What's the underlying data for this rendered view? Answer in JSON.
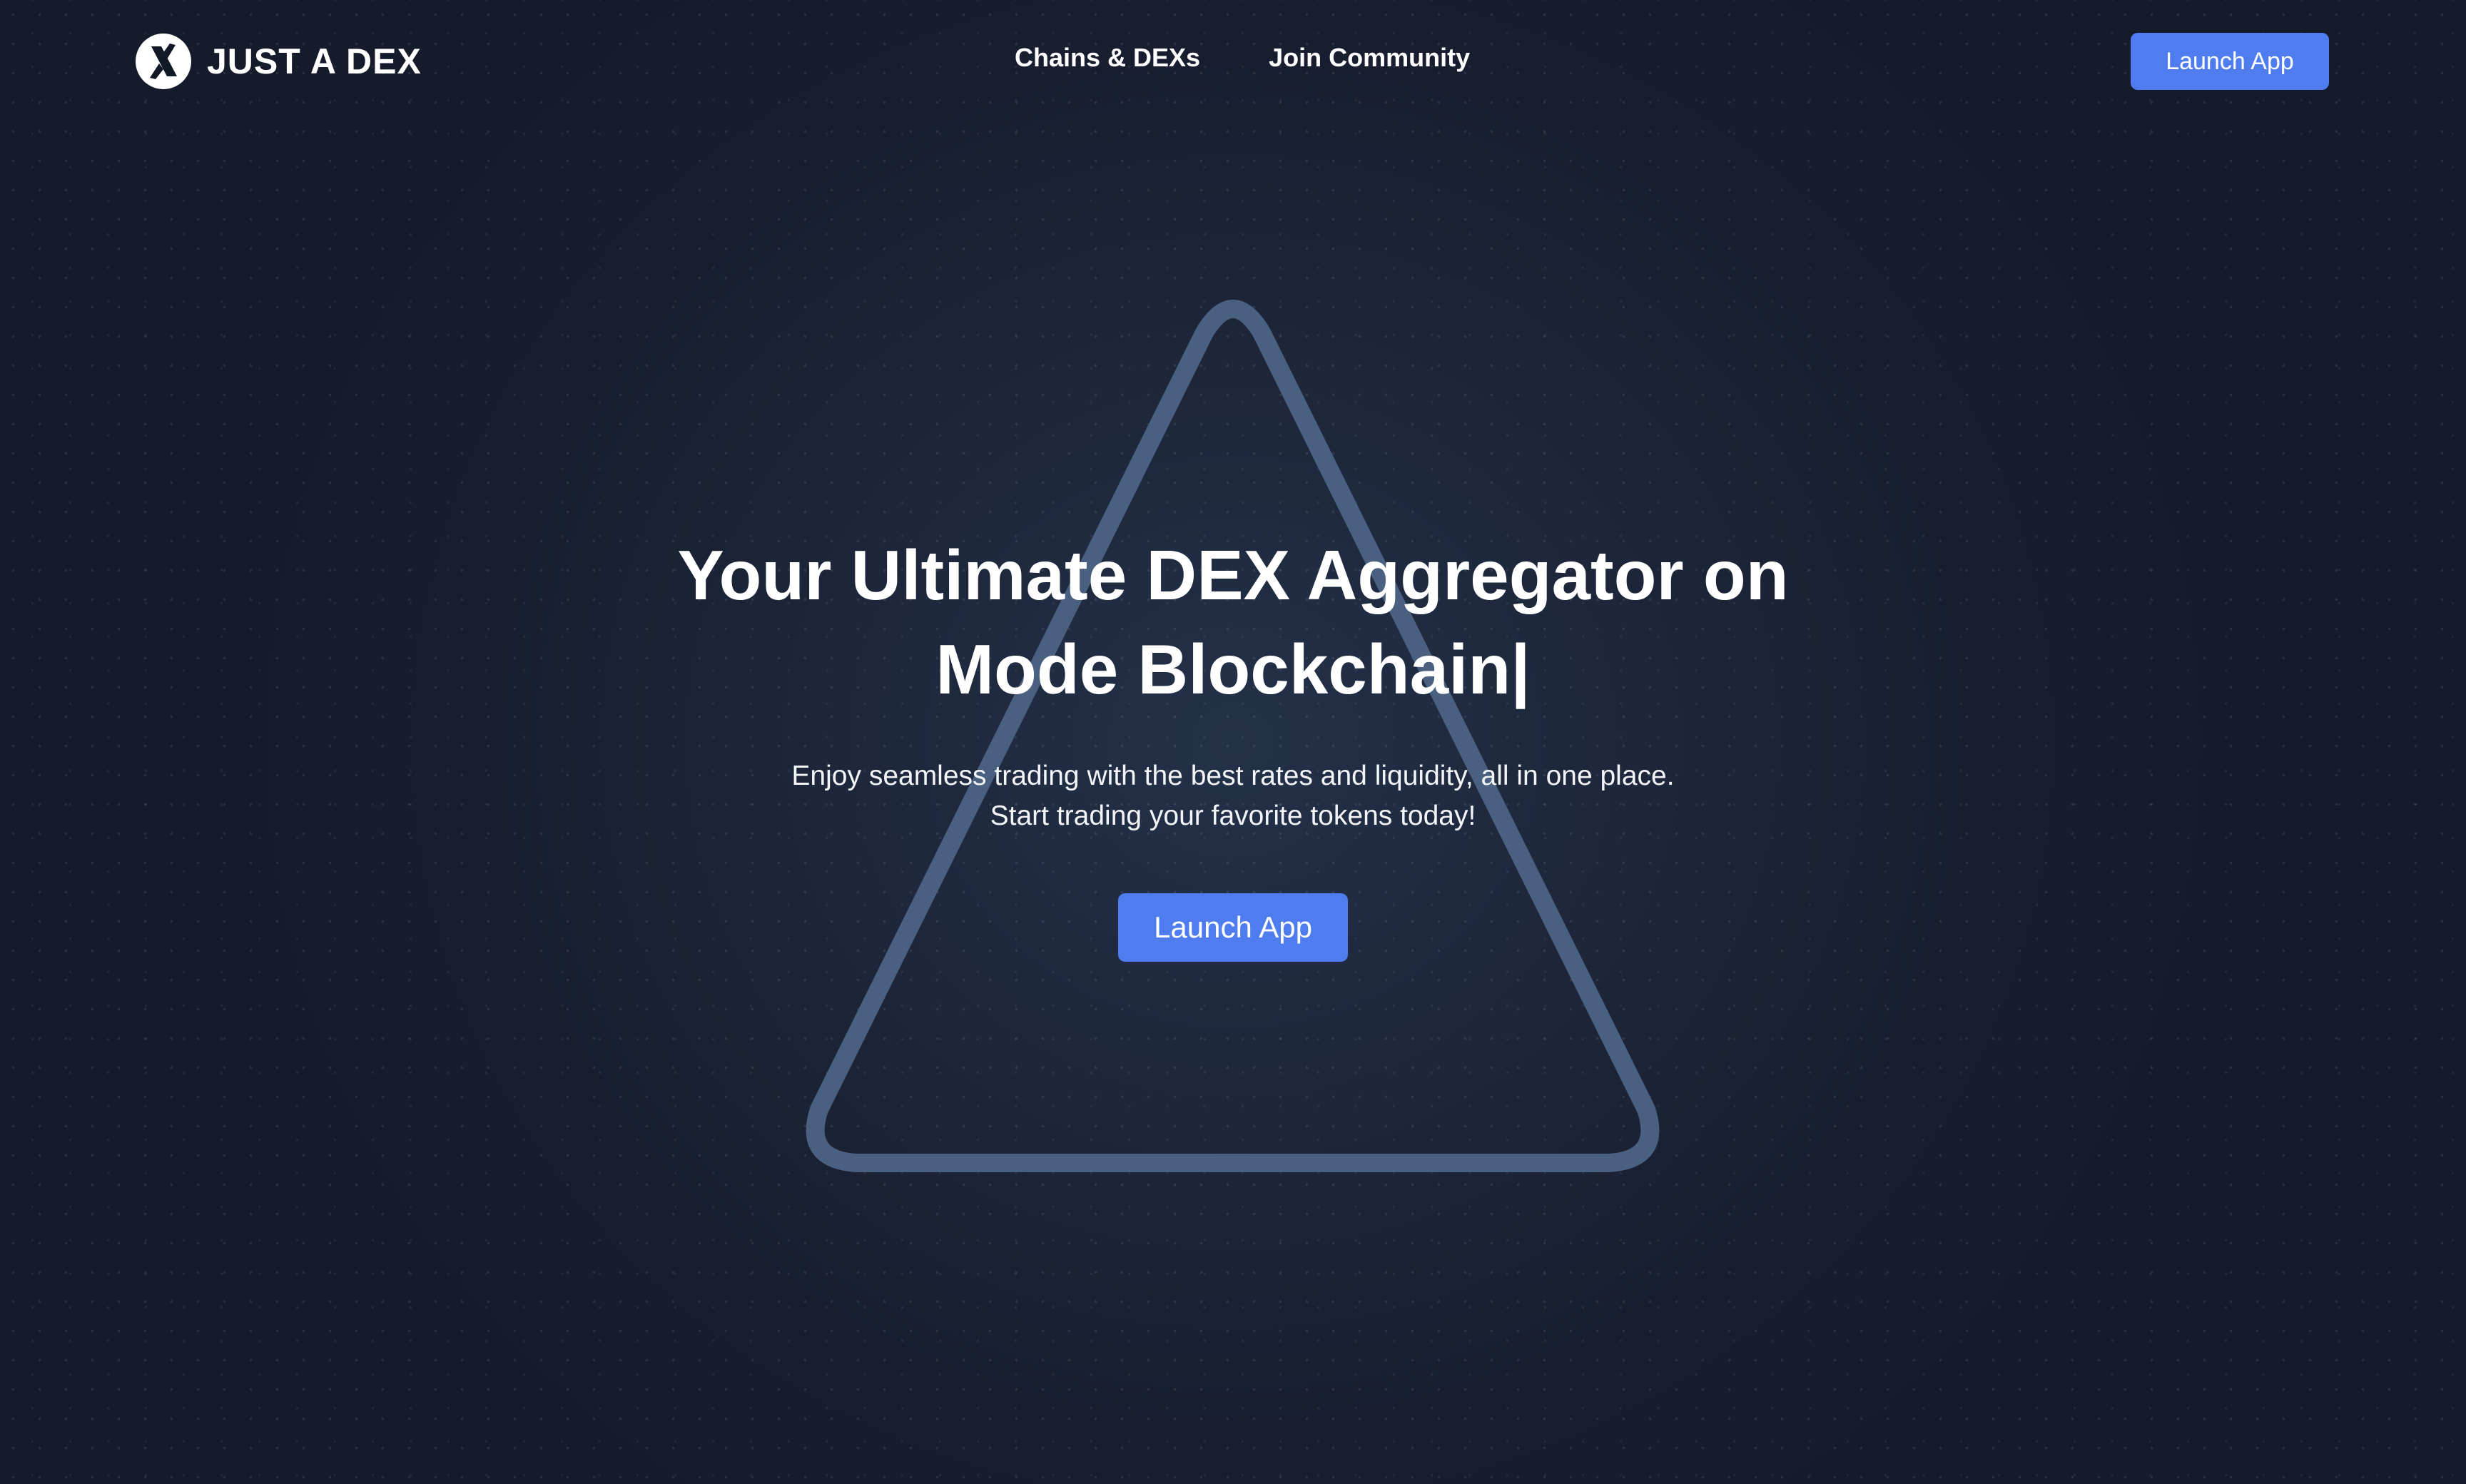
{
  "brand": {
    "name": "JUST A DEX",
    "logo_icon": "x-circle-logo"
  },
  "nav": {
    "links": [
      {
        "label": "Chains & DEXs"
      },
      {
        "label": "Join Community"
      }
    ],
    "cta_label": "Launch App"
  },
  "hero": {
    "title_line1": "Your Ultimate DEX Aggregator on",
    "title_line2": "Mode Blockchain|",
    "subtitle_line1": "Enjoy seamless trading with the best rates and liquidity, all in one place.",
    "subtitle_line2": "Start trading your favorite tokens today!",
    "cta_label": "Launch App"
  },
  "colors": {
    "accent": "#4f7df0",
    "background": "#1b2235",
    "triangle_stroke": "#4a6080"
  }
}
